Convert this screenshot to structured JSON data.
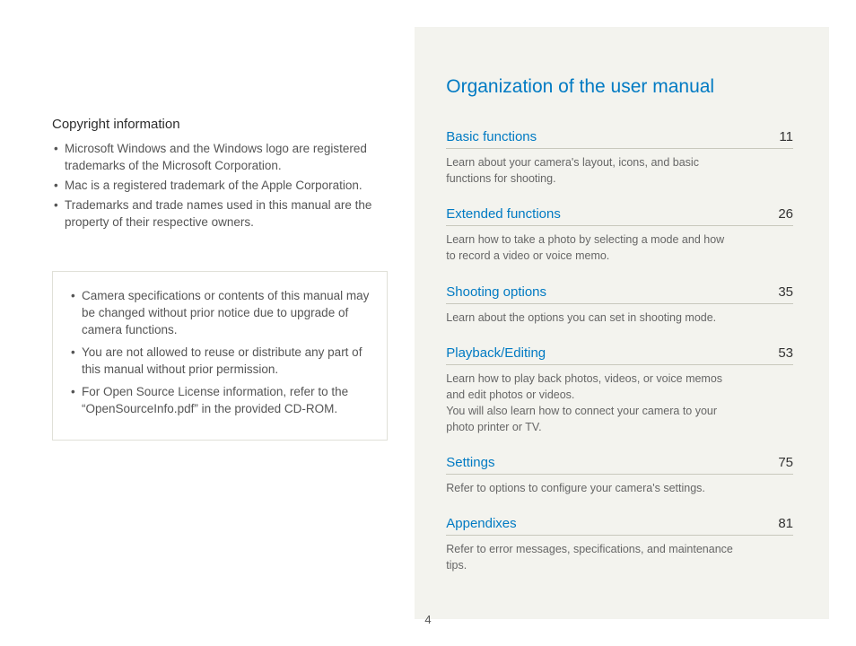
{
  "page_number": "4",
  "left": {
    "copyright_title": "Copyright information",
    "bullets": [
      "Microsoft Windows and the Windows logo are registered trademarks of the Microsoft Corporation.",
      "Mac is a registered trademark of the Apple Corporation.",
      "Trademarks and trade names used in this manual are the property of their respective owners."
    ],
    "notice_bullets": [
      "Camera specifications or contents of this manual may be changed without prior notice due to upgrade of camera functions.",
      "You are not allowed to reuse or distribute any part of this manual without prior permission.",
      "For Open Source License information, refer to the “OpenSourceInfo.pdf” in the provided CD-ROM."
    ]
  },
  "right": {
    "title": "Organization of the user manual",
    "toc": [
      {
        "title": "Basic functions",
        "page": "11",
        "desc": "Learn about your camera's layout, icons, and basic functions for shooting."
      },
      {
        "title": "Extended functions",
        "page": "26",
        "desc": "Learn how to take a photo by selecting a mode and how to record a video or voice memo."
      },
      {
        "title": "Shooting options",
        "page": "35",
        "desc": "Learn about the options you can set in shooting mode."
      },
      {
        "title": "Playback/Editing",
        "page": "53",
        "desc": "Learn how to play back photos, videos, or voice memos and edit photos or videos.\nYou will also learn how to connect your camera to your photo printer or TV."
      },
      {
        "title": "Settings",
        "page": "75",
        "desc": "Refer to options to configure your camera's settings."
      },
      {
        "title": "Appendixes",
        "page": "81",
        "desc": "Refer to error messages, specifications, and maintenance tips."
      }
    ]
  }
}
